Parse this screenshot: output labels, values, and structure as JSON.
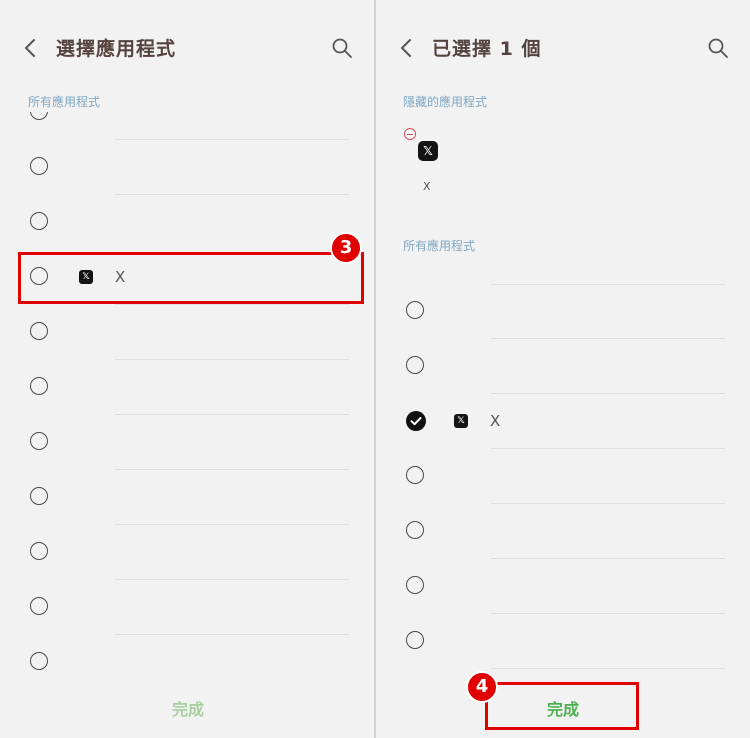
{
  "left": {
    "title": "選擇應用程式",
    "section_label": "所有應用程式",
    "highlighted_app": {
      "name": "X",
      "icon": "x-logo-icon"
    },
    "done_label": "完成",
    "step_badge": "3"
  },
  "right": {
    "title": "已選擇 1 個",
    "hidden_section_label": "隱藏的應用程式",
    "hidden_app": {
      "name": "X",
      "icon": "x-logo-icon"
    },
    "section_label": "所有應用程式",
    "selected_app": {
      "name": "X",
      "icon": "x-logo-icon",
      "checked": true
    },
    "done_label": "完成",
    "step_badge": "4"
  },
  "colors": {
    "highlight": "#e00000",
    "done_active": "#4caf50",
    "done_inactive": "#a8cf9e",
    "section_label": "#7fa7c4",
    "title": "#55433f"
  },
  "icons": {
    "back": "chevron-left-icon",
    "search": "search-icon",
    "check": "check-circle-icon",
    "remove": "remove-minus-icon"
  }
}
